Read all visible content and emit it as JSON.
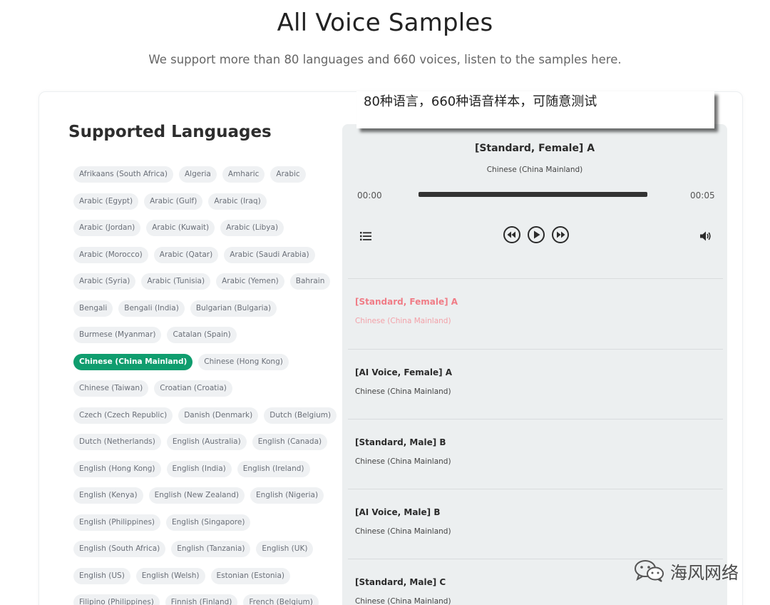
{
  "header": {
    "title": "All Voice Samples",
    "subtitle": "We support more than 80 languages and 660 voices, listen to the samples here."
  },
  "languages": {
    "title": "Supported Languages",
    "rows": [
      [
        "Afrikaans (South Africa)",
        "Algeria",
        "Amharic",
        "Arabic"
      ],
      [
        "Arabic (Egypt)",
        "Arabic (Gulf)",
        "Arabic (Iraq)"
      ],
      [
        "Arabic (Jordan)",
        "Arabic (Kuwait)",
        "Arabic (Libya)"
      ],
      [
        "Arabic (Morocco)",
        "Arabic (Qatar)",
        "Arabic (Saudi Arabia)"
      ],
      [
        "Arabic (Syria)",
        "Arabic (Tunisia)",
        "Arabic (Yemen)",
        "Bahrain"
      ],
      [
        "Bengali",
        "Bengali (India)",
        "Bulgarian (Bulgaria)"
      ],
      [
        "Burmese (Myanmar)",
        "Catalan (Spain)"
      ],
      [
        "Chinese (China Mainland)",
        "Chinese (Hong Kong)"
      ],
      [
        "Chinese (Taiwan)",
        "Croatian (Croatia)"
      ],
      [
        "Czech (Czech Republic)",
        "Danish (Denmark)",
        "Dutch (Belgium)"
      ],
      [
        "Dutch (Netherlands)",
        "English (Australia)",
        "English (Canada)"
      ],
      [
        "English (Hong Kong)",
        "English (India)",
        "English (Ireland)"
      ],
      [
        "English (Kenya)",
        "English (New Zealand)",
        "English (Nigeria)"
      ],
      [
        "English (Philippines)",
        "English (Singapore)"
      ],
      [
        "English (South Africa)",
        "English (Tanzania)",
        "English (UK)"
      ],
      [
        "English (US)",
        "English (Welsh)",
        "Estonian (Estonia)"
      ],
      [
        "Filipino (Philippines)",
        "Finnish (Finland)",
        "French (Belgium)"
      ]
    ],
    "selected": "Chinese (China Mainland)"
  },
  "player": {
    "current_title": "[Standard, Female] A",
    "current_language": "Chinese (China Mainland)",
    "time_elapsed": "00:00",
    "time_total": "00:05",
    "progress": 0,
    "icons": {
      "list": "playlist-icon",
      "prev": "rewind-icon",
      "play": "play-icon",
      "next": "fast-forward-icon",
      "volume": "volume-icon"
    },
    "playlist": [
      {
        "title": "[Standard, Female] A",
        "language": "Chinese (China Mainland)",
        "active": true
      },
      {
        "title": "[AI Voice, Female] A",
        "language": "Chinese (China Mainland)",
        "active": false
      },
      {
        "title": "[Standard, Male] B",
        "language": "Chinese (China Mainland)",
        "active": false
      },
      {
        "title": "[AI Voice, Male] B",
        "language": "Chinese (China Mainland)",
        "active": false
      },
      {
        "title": "[Standard, Male] C",
        "language": "Chinese (China Mainland)",
        "active": false
      }
    ]
  },
  "callout": {
    "text": "80种语言，660种语音样本，可随意测试"
  },
  "watermark": {
    "text": "海风网络"
  },
  "colors": {
    "accent": "#0f9d6e",
    "active_track": "#f07c86",
    "player_bg": "#eceff0"
  }
}
